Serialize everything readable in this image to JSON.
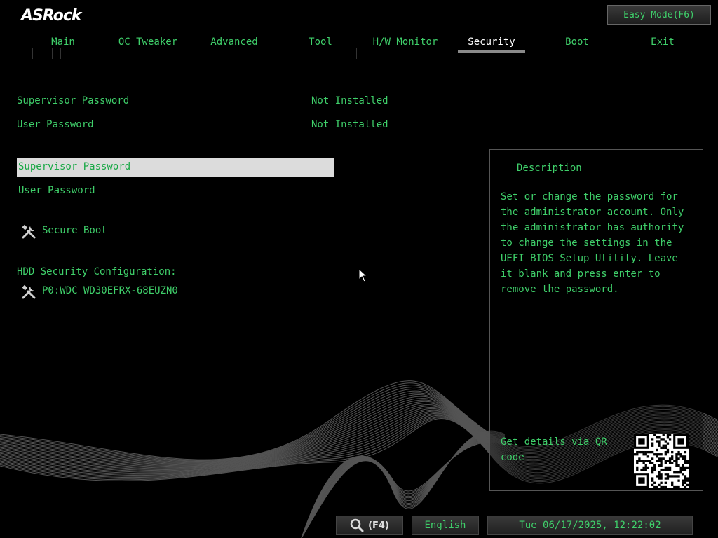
{
  "brand": "ASRock",
  "header": {
    "easy_mode": "Easy Mode(F6)"
  },
  "tabs": [
    {
      "label": "Main"
    },
    {
      "label": "OC Tweaker"
    },
    {
      "label": "Advanced"
    },
    {
      "label": "Tool"
    },
    {
      "label": "H/W Monitor"
    },
    {
      "label": "Security",
      "active": true
    },
    {
      "label": "Boot"
    },
    {
      "label": "Exit"
    }
  ],
  "status": [
    {
      "label": "Supervisor Password",
      "value": "Not Installed"
    },
    {
      "label": "User Password",
      "value": "Not Installed"
    }
  ],
  "menu": {
    "supervisor": "Supervisor Password",
    "user": "User Password",
    "secure_boot": "Secure Boot",
    "hdd_heading": "HDD Security Configuration:",
    "hdd_item": "P0:WDC WD30EFRX-68EUZN0"
  },
  "description": {
    "title": "Description",
    "text": "Set or change the password for the administrator account. Only the administrator has authority to change the settings in the UEFI BIOS Setup Utility. Leave it blank and press enter to remove the password.",
    "qr_text": "Get details via QR code"
  },
  "footer": {
    "search_key": "(F4)",
    "language": "English",
    "datetime": "Tue 06/17/2025, 12:22:02"
  },
  "colors": {
    "text": "#3fcf6a",
    "highlight": "#dcdcdc",
    "active_tab": "#ffffff"
  }
}
